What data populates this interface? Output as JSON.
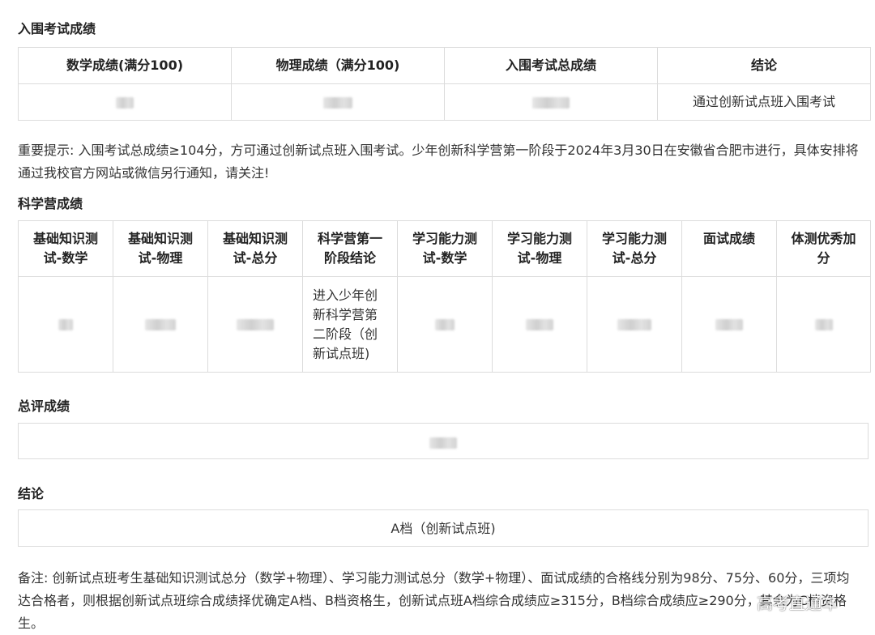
{
  "section1": {
    "title": "入围考试成绩",
    "headers": [
      "数学成绩(满分100)",
      "物理成绩（满分100)",
      "入围考试总成绩",
      "结论"
    ],
    "conclusion": "通过创新试点班入围考试"
  },
  "notice1": "重要提示: 入围考试总成绩≥104分，方可通过创新试点班入围考试。少年创新科学营第一阶段于2024年3月30日在安徽省合肥市进行，具体安排将通过我校官方网站或微信另行通知，请关注!",
  "section2": {
    "title": "科学营成绩",
    "headers": [
      "基础知识测试-数学",
      "基础知识测试-物理",
      "基础知识测试-总分",
      "科学营第一阶段结论",
      "学习能力测试-数学",
      "学习能力测试-物理",
      "学习能力测试-总分",
      "面试成绩",
      "体测优秀加分"
    ],
    "stage_conclusion": "进入少年创新科学营第二阶段（创新试点班)"
  },
  "section3": {
    "title": "总评成绩"
  },
  "section4": {
    "title": "结论",
    "value": "A档（创新试点班)"
  },
  "footnote": "备注: 创新试点班考生基础知识测试总分（数学+物理）、学习能力测试总分（数学+物理）、面试成绩的合格线分别为98分、75分、60分，三项均达合格者，则根据创新试点班综合成绩择优确定A档、B档资格生，创新试点班A档综合成绩应≥315分，B档综合成绩应≥290分，其余为C档资格生。",
  "watermark": "高考直通车"
}
